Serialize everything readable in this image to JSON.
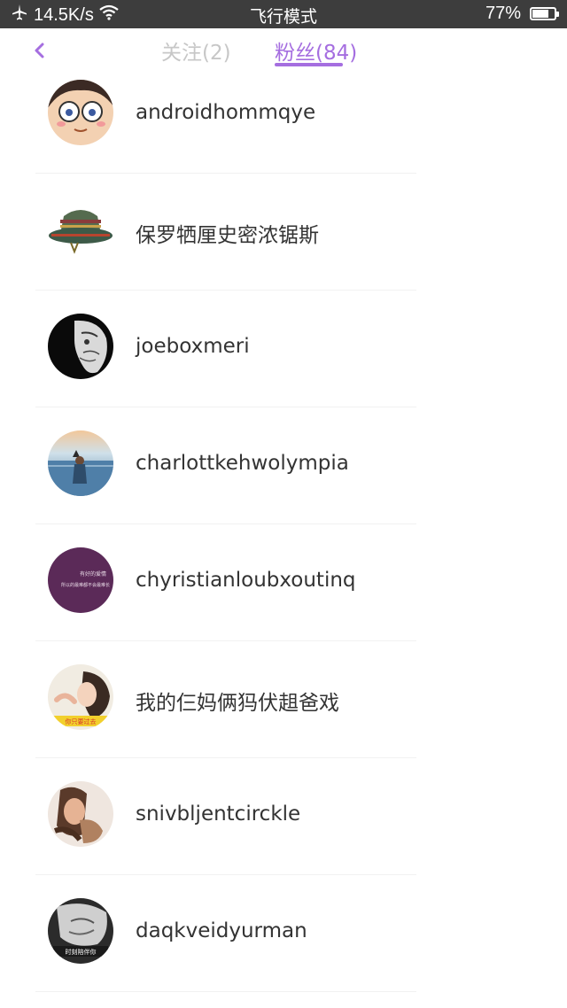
{
  "status_bar": {
    "network_speed": "14.5K/s",
    "mode": "飞行模式",
    "battery_percent_text": "77%",
    "battery_level": 0.77,
    "icons": [
      "airplane-icon",
      "wifi-icon",
      "battery-icon"
    ]
  },
  "header": {
    "back_icon": "chevron-left-icon",
    "tabs": [
      {
        "label": "关注(2)",
        "active": false
      },
      {
        "label": "粉丝(84)",
        "active": true
      }
    ]
  },
  "colors": {
    "accent": "#a56ee0",
    "inactive_tab": "#c7c7c7",
    "status_bar_bg": "#3d3d3d",
    "text": "#333333"
  },
  "followers": [
    {
      "name": "androidhommqye"
    },
    {
      "name": "保罗牺厘史密浓锯斯"
    },
    {
      "name": "joeboxmeri"
    },
    {
      "name": "charlottkehwolympia"
    },
    {
      "name": "chyristianloubxoutinq"
    },
    {
      "name": "我的仨妈俩犸伏趄爸戏"
    },
    {
      "name": "snivbljentcirckle"
    },
    {
      "name": "daqkveidyurman"
    }
  ],
  "avatar_texts": {
    "item5": [
      "有好的爱情",
      "所以的最难都不会最难长"
    ],
    "item6": [
      "你只要过去"
    ],
    "item8": [
      "时刻陪伴你"
    ]
  }
}
